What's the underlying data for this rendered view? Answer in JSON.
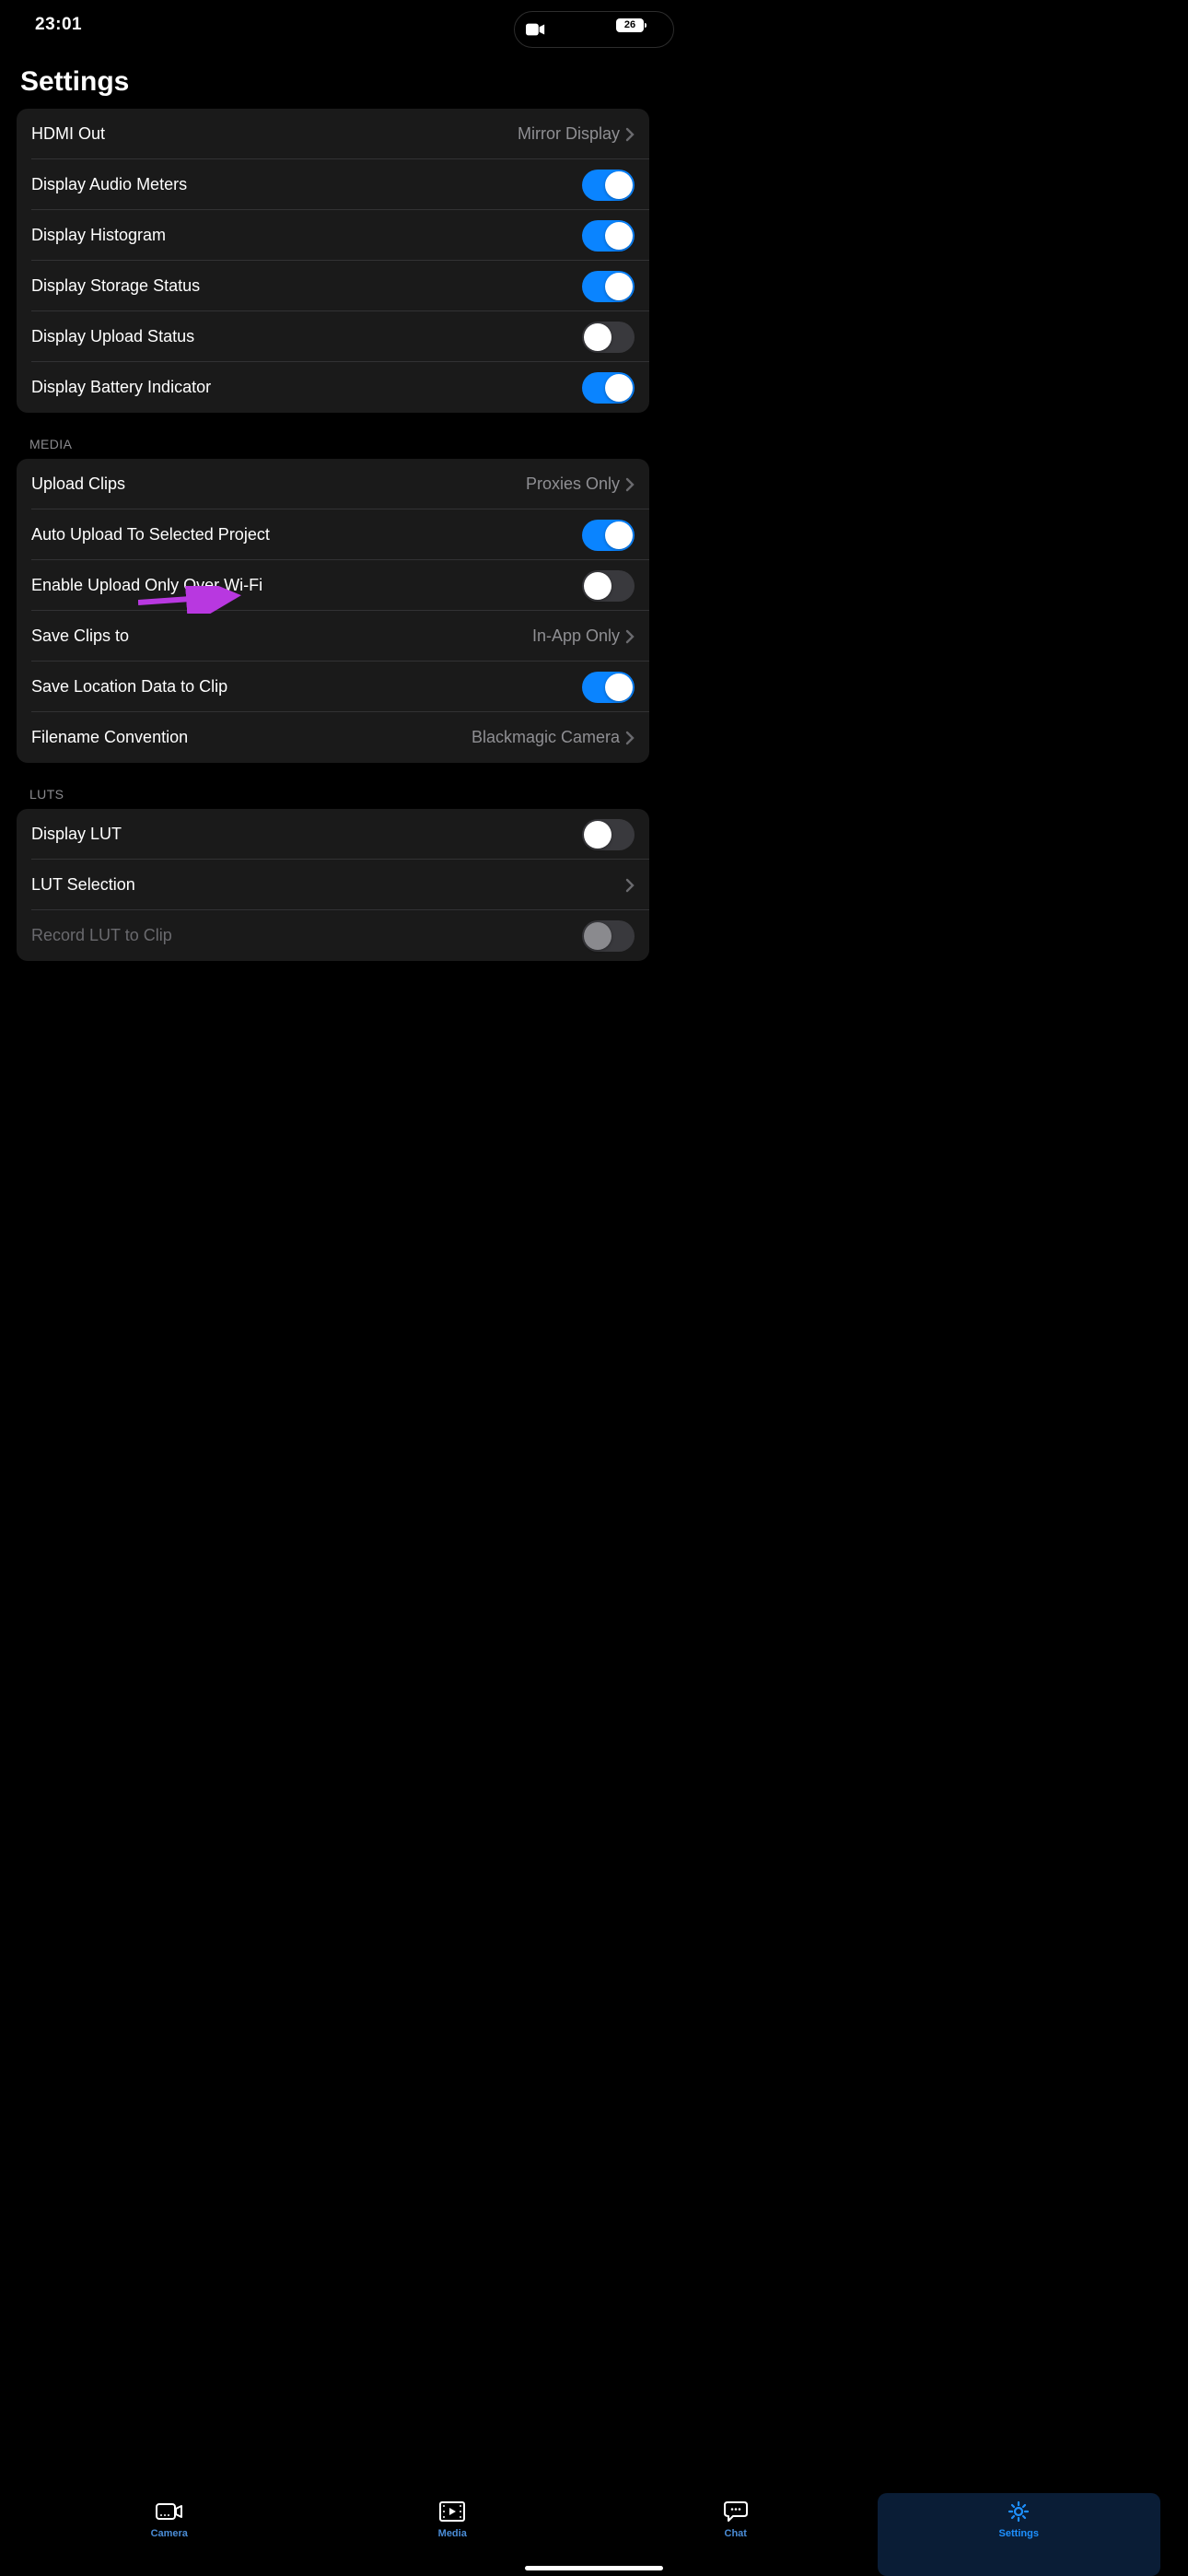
{
  "status": {
    "time": "23:01",
    "battery": "26"
  },
  "page": {
    "title": "Settings"
  },
  "sections": {
    "display": {
      "hdmi_out": {
        "label": "HDMI Out",
        "value": "Mirror Display"
      },
      "audio_meters": {
        "label": "Display Audio Meters"
      },
      "histogram": {
        "label": "Display Histogram"
      },
      "storage_status": {
        "label": "Display Storage Status"
      },
      "upload_status": {
        "label": "Display Upload Status"
      },
      "battery_indicator": {
        "label": "Display Battery Indicator"
      }
    },
    "media": {
      "header": "MEDIA",
      "upload_clips": {
        "label": "Upload Clips",
        "value": "Proxies Only"
      },
      "auto_upload": {
        "label": "Auto Upload To Selected Project"
      },
      "wifi_only": {
        "label": "Enable Upload Only Over Wi-Fi"
      },
      "save_clips": {
        "label": "Save Clips to",
        "value": "In-App Only"
      },
      "location_data": {
        "label": "Save Location Data to Clip"
      },
      "filename": {
        "label": "Filename Convention",
        "value": "Blackmagic Camera"
      }
    },
    "luts": {
      "header": "LUTS",
      "display_lut": {
        "label": "Display LUT"
      },
      "lut_selection": {
        "label": "LUT Selection"
      },
      "record_lut": {
        "label": "Record LUT to Clip"
      }
    }
  },
  "toggles": {
    "audio_meters": "on",
    "histogram": "on",
    "storage_status": "on",
    "upload_status": "off",
    "battery_indicator": "on",
    "auto_upload": "on",
    "wifi_only": "off",
    "location_data": "on",
    "display_lut": "off",
    "record_lut": "disabled"
  },
  "tabs": {
    "camera": "Camera",
    "media": "Media",
    "chat": "Chat",
    "settings": "Settings"
  }
}
